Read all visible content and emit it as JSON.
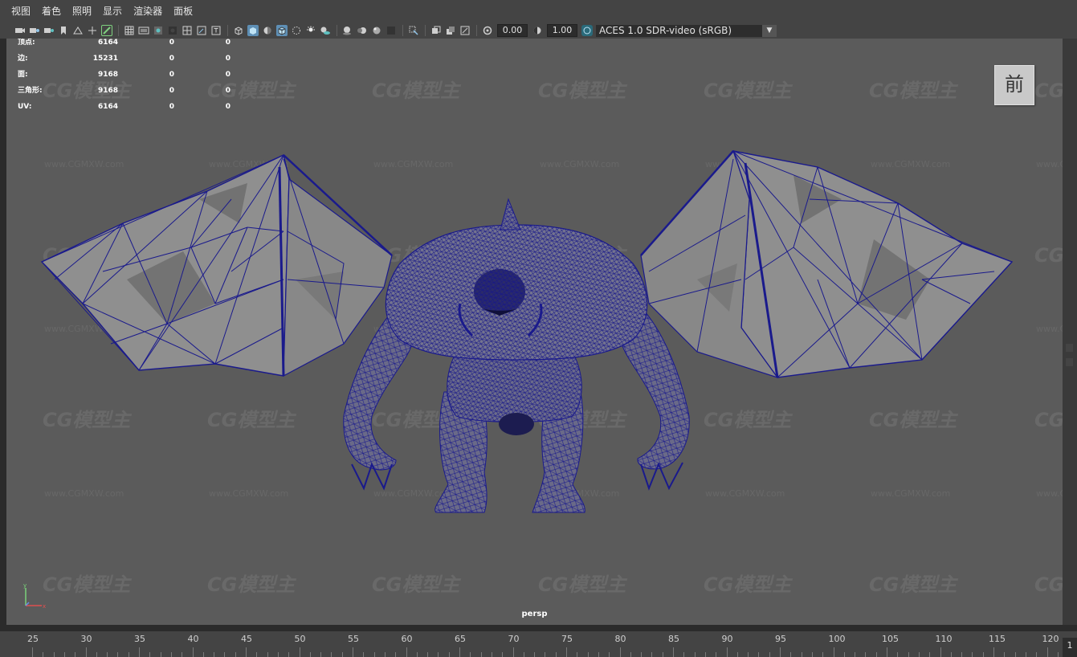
{
  "menu": [
    "视图",
    "着色",
    "照明",
    "显示",
    "渲染器",
    "面板"
  ],
  "toolbar": {
    "exposure": "0.00",
    "gamma": "1.00",
    "color_space": "ACES 1.0 SDR-video (sRGB)",
    "icons_group1": [
      "camera-select-icon",
      "camera-attributes-icon",
      "bookmark-icon",
      "image-plane-icon",
      "2d-pan-zoom-icon",
      "grease-pencil-icon"
    ],
    "icons_group2": [
      "grid-icon",
      "film-gate-icon",
      "resolution-gate-icon",
      "gate-mask-icon",
      "field-chart-icon",
      "safe-action-icon",
      "safe-title-icon"
    ],
    "icons_group3": [
      "wireframe-icon",
      "smooth-shade-icon",
      "default-material-icon",
      "wireframe-on-shaded-icon",
      "textured-icon",
      "use-all-lights-icon",
      "shadows-icon"
    ],
    "icons_group4": [
      "screen-space-ao-icon",
      "motion-blur-icon",
      "multisample-aa-icon",
      "depth-of-field-icon"
    ],
    "icons_group5": [
      "isolate-select-icon",
      "xray-icon",
      "xray-active-icon",
      "xray-joints-icon"
    ]
  },
  "hud": {
    "rows": [
      {
        "label": "顶点:",
        "v1": "6164",
        "v2": "0",
        "v3": "0"
      },
      {
        "label": "边:",
        "v1": "15231",
        "v2": "0",
        "v3": "0"
      },
      {
        "label": "面:",
        "v1": "9168",
        "v2": "0",
        "v3": "0"
      },
      {
        "label": "三角形:",
        "v1": "9168",
        "v2": "0",
        "v3": "0"
      },
      {
        "label": "UV:",
        "v1": "6164",
        "v2": "0",
        "v3": "0"
      }
    ]
  },
  "viewcube": {
    "label": "前"
  },
  "camera": {
    "name": "persp"
  },
  "axis": {
    "y": "y",
    "x": "x",
    "z": "z"
  },
  "watermark": {
    "logo": "CG模型主",
    "url": "www.CGMXW.com"
  },
  "timeline": {
    "ticks": [
      "25",
      "30",
      "35",
      "40",
      "45",
      "50",
      "55",
      "60",
      "65",
      "70",
      "75",
      "80",
      "85",
      "90",
      "95",
      "100",
      "105",
      "110",
      "115",
      "120"
    ],
    "current_frame": "1"
  },
  "colors": {
    "wire": "#1a1a8c",
    "viewport_bg": "#5b5b5b",
    "accent": "#5e8fb5"
  }
}
